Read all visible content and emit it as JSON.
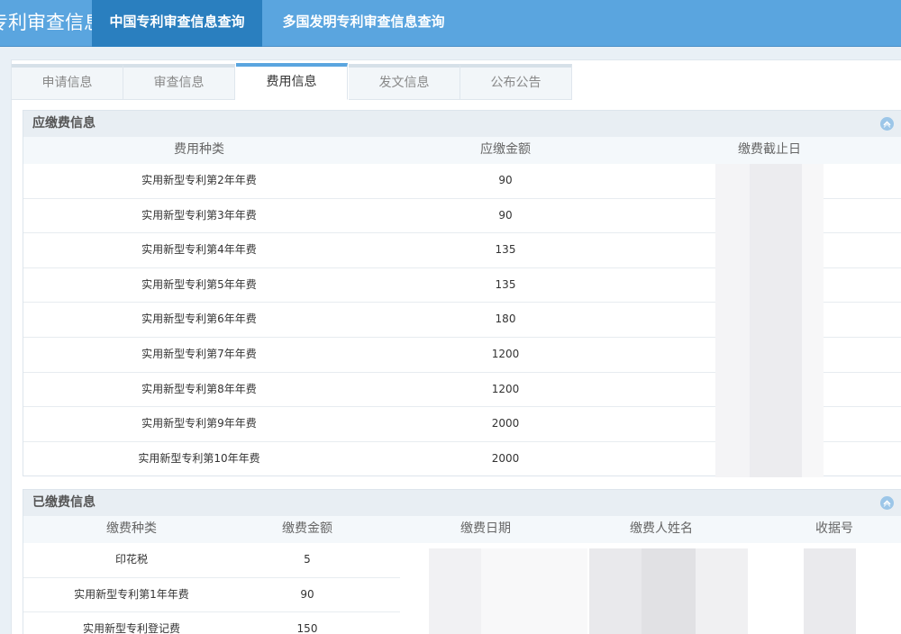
{
  "header": {
    "brand": "专利审查信息查询",
    "nav": [
      {
        "label": "中国专利审查信息查询",
        "active": true
      },
      {
        "label": "多国发明专利审查信息查询",
        "active": false
      }
    ]
  },
  "subtabs": [
    {
      "label": "申请信息",
      "active": false
    },
    {
      "label": "审查信息",
      "active": false
    },
    {
      "label": "费用信息",
      "active": true
    },
    {
      "label": "发文信息",
      "active": false
    },
    {
      "label": "公布公告",
      "active": false
    }
  ],
  "due_fees": {
    "title": "应缴费信息",
    "columns": [
      "费用种类",
      "应缴金额",
      "缴费截止日"
    ],
    "rows": [
      {
        "type": "实用新型专利第2年年费",
        "amount": "90"
      },
      {
        "type": "实用新型专利第3年年费",
        "amount": "90"
      },
      {
        "type": "实用新型专利第4年年费",
        "amount": "135"
      },
      {
        "type": "实用新型专利第5年年费",
        "amount": "135"
      },
      {
        "type": "实用新型专利第6年年费",
        "amount": "180"
      },
      {
        "type": "实用新型专利第7年年费",
        "amount": "1200"
      },
      {
        "type": "实用新型专利第8年年费",
        "amount": "1200"
      },
      {
        "type": "实用新型专利第9年年费",
        "amount": "2000"
      },
      {
        "type": "实用新型专利第10年年费",
        "amount": "2000"
      }
    ]
  },
  "paid_fees": {
    "title": "已缴费信息",
    "columns": [
      "缴费种类",
      "缴费金额",
      "缴费日期",
      "缴费人姓名",
      "收据号"
    ],
    "rows": [
      {
        "type": "印花税",
        "amount": "5"
      },
      {
        "type": "实用新型专利第1年年费",
        "amount": "90"
      },
      {
        "type": "实用新型专利登记费",
        "amount": "150"
      }
    ]
  },
  "colors": {
    "nav_bg": "#5aa5df",
    "nav_active": "#2a7fbf",
    "accent": "#5aa5df",
    "panel_head": "#e8eef3"
  }
}
